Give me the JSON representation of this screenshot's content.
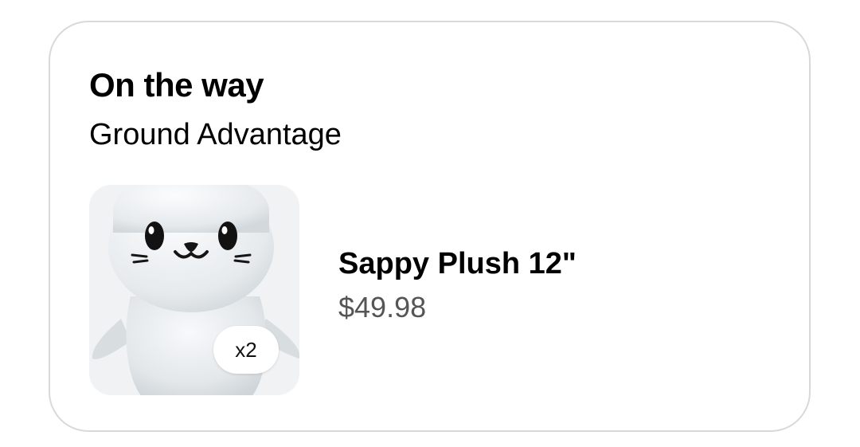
{
  "shipment": {
    "status_title": "On the way",
    "service": "Ground Advantage"
  },
  "item": {
    "name": "Sappy Plush 12\"",
    "price": "$49.98",
    "quantity_badge": "x2",
    "image_icon": "seal-plush-image"
  },
  "colors": {
    "card_border": "#d9d9d9",
    "price_text": "#555555",
    "image_bg": "#f1f2f3"
  }
}
